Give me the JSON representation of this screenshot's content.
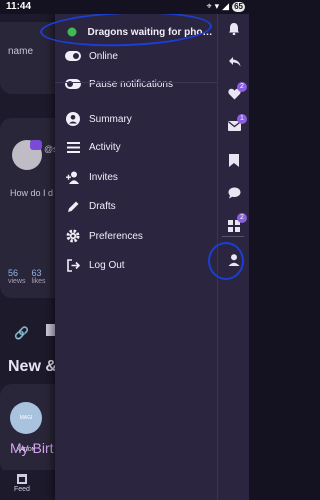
{
  "status_bar": {
    "time": "11:44",
    "battery": "65"
  },
  "background": {
    "name_fragment": "name",
    "at_fragment": "@s",
    "question_fragment": "How do I d",
    "stats": [
      {
        "num": "56",
        "label": "views"
      },
      {
        "num": "63",
        "label": "likes"
      }
    ],
    "section_fragment": "New & U",
    "logo_text": "MAGI NATION",
    "title_fragment": "My Birt",
    "feed_tab_label": "Feed"
  },
  "drawer": {
    "status_text": "Dragons waiting for photo s...",
    "items": [
      {
        "label": "Online",
        "icon": "toggle-icon"
      },
      {
        "label": "Pause notifications",
        "icon": "toggle-icon"
      },
      {
        "label": "Summary",
        "icon": "user-icon"
      },
      {
        "label": "Activity",
        "icon": "list-icon"
      },
      {
        "label": "Invites",
        "icon": "add-user-icon"
      },
      {
        "label": "Drafts",
        "icon": "pencil-icon"
      },
      {
        "label": "Preferences",
        "icon": "gear-icon"
      },
      {
        "label": "Log Out",
        "icon": "logout-icon"
      }
    ]
  },
  "rail": {
    "badges": {
      "likes": "2",
      "messages": "1",
      "grid": "2"
    }
  },
  "colors": {
    "accent": "#8a5fe0",
    "drawer_bg": "#2b2540",
    "annotation": "#1b3fd6",
    "status_dot": "#3fb950"
  }
}
